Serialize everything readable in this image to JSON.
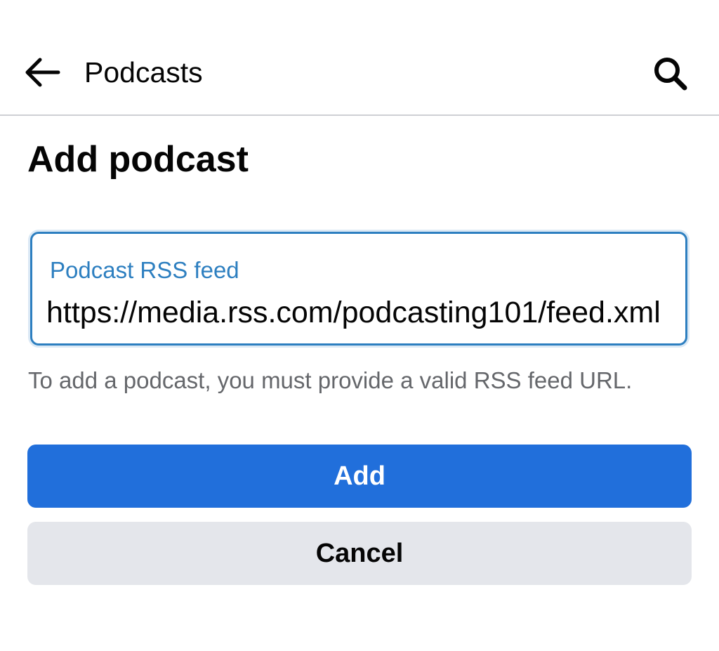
{
  "header": {
    "back_icon": "arrow-left-icon",
    "title": "Podcasts",
    "search_icon": "search-icon"
  },
  "page": {
    "title": "Add podcast"
  },
  "rss_field": {
    "label": "Podcast RSS feed",
    "value": "https://media.rss.com/podcasting101/feed.xml"
  },
  "help_text": "To add a podcast, you must provide a valid RSS feed URL.",
  "buttons": {
    "add_label": "Add",
    "cancel_label": "Cancel"
  },
  "colors": {
    "primary": "#216fdb",
    "field_focus": "#2d7fc0",
    "secondary_bg": "#e4e6eb",
    "muted_text": "#65676b"
  }
}
